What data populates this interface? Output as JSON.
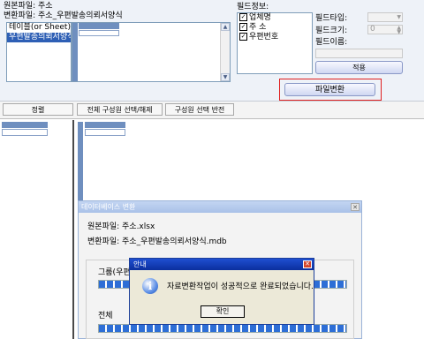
{
  "top": {
    "source_file_label": "원본파일:",
    "source_file_value": "주소",
    "convert_file_label": "변환파일:",
    "convert_file_value": "주소_우편발송의뢰서양식",
    "table_list_header": "테이블(or Sheet)",
    "table_list_selected": "우편발송의뢰서양식",
    "field_info_label": "필드정보:",
    "fields": [
      {
        "label": "업체명",
        "checked": true
      },
      {
        "label": "주 소",
        "checked": true
      },
      {
        "label": "우편번호",
        "checked": true
      }
    ],
    "field_type_label": "필드타입:",
    "field_size_label": "필드크기:",
    "field_size_value": "0",
    "field_name_label": "필드이름:",
    "apply_button": "적용",
    "convert_button": "파일변환"
  },
  "toolbar": {
    "sort": "정렬",
    "select_all": "전체 구성원 선택/해제",
    "invert": "구성원 선택 반전"
  },
  "db_dialog": {
    "title": "데이터베이스 변환",
    "source_line": "원본파일: 주소.xlsx",
    "convert_line": "변환파일: 주소_우편발송의뢰서양식.mdb",
    "group_label": "그룹(우편",
    "total_label": "전체"
  },
  "alert": {
    "title": "안내",
    "message": "자료변환작업이 성공적으로 완료되었습니다.",
    "ok_button": "확인"
  },
  "colors": {
    "highlight_border": "#e02020",
    "title_blue": "#0b2f9e",
    "progress_blue": "#2d6ed6"
  }
}
